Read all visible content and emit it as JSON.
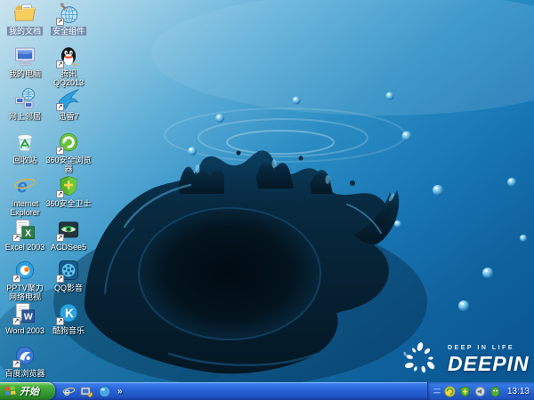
{
  "desktop": {
    "icons_col1": [
      {
        "name": "my-documents",
        "label": "我的文档",
        "selected": true,
        "arrow": false
      },
      {
        "name": "my-computer",
        "label": "我的电脑",
        "selected": false,
        "arrow": false
      },
      {
        "name": "network-places",
        "label": "网上邻居",
        "selected": false,
        "arrow": false
      },
      {
        "name": "recycle-bin",
        "label": "回收站",
        "selected": false,
        "arrow": false
      },
      {
        "name": "internet-explorer",
        "label": "Internet Explorer",
        "selected": false,
        "arrow": false
      },
      {
        "name": "excel-2003",
        "label": "Excel 2003",
        "selected": false,
        "arrow": true
      },
      {
        "name": "pptv",
        "label": "PPTV聚力 网络电视",
        "selected": false,
        "arrow": true
      },
      {
        "name": "word-2003",
        "label": "Word 2003",
        "selected": false,
        "arrow": true
      },
      {
        "name": "baidu-browser",
        "label": "百度浏览器",
        "selected": false,
        "arrow": true
      }
    ],
    "icons_col2": [
      {
        "name": "security-component",
        "label": "安全组件",
        "selected": true,
        "arrow": true
      },
      {
        "name": "tencent-qq",
        "label": "腾讯QQ2013",
        "selected": false,
        "arrow": true
      },
      {
        "name": "thunder7",
        "label": "迅雷7",
        "selected": false,
        "arrow": true
      },
      {
        "name": "browser-360",
        "label": "360安全浏览器",
        "selected": false,
        "arrow": true
      },
      {
        "name": "safe-360",
        "label": "360安全卫士",
        "selected": false,
        "arrow": true
      },
      {
        "name": "acdsee5",
        "label": "ACDSee5",
        "selected": false,
        "arrow": true
      },
      {
        "name": "qq-player",
        "label": "QQ影音",
        "selected": false,
        "arrow": true
      },
      {
        "name": "kugou-music",
        "label": "酷狗音乐",
        "selected": false,
        "arrow": true
      }
    ],
    "watermark": {
      "tagline": "DEEP IN LIFE",
      "brand": "DEEPIN"
    }
  },
  "taskbar": {
    "start_label": "开始",
    "quick_launch": [
      {
        "name": "internet-explorer"
      },
      {
        "name": "show-desktop"
      },
      {
        "name": "media-player"
      }
    ],
    "overflow_chevron": "»",
    "tray_icons": [
      {
        "name": "antivirus-360"
      },
      {
        "name": "security-shield-360"
      },
      {
        "name": "volume"
      },
      {
        "name": "green-assistant"
      }
    ],
    "clock": "13:13"
  },
  "colors": {
    "wallpaper_light": "#d9f2fb",
    "wallpaper_deep": "#0a5d9e",
    "splash_dark": "#041724",
    "taskbar_blue": "#2663d8",
    "start_green": "#379a31",
    "selection_grey_blue": "#6883a4",
    "label_text": "#ffffff"
  }
}
